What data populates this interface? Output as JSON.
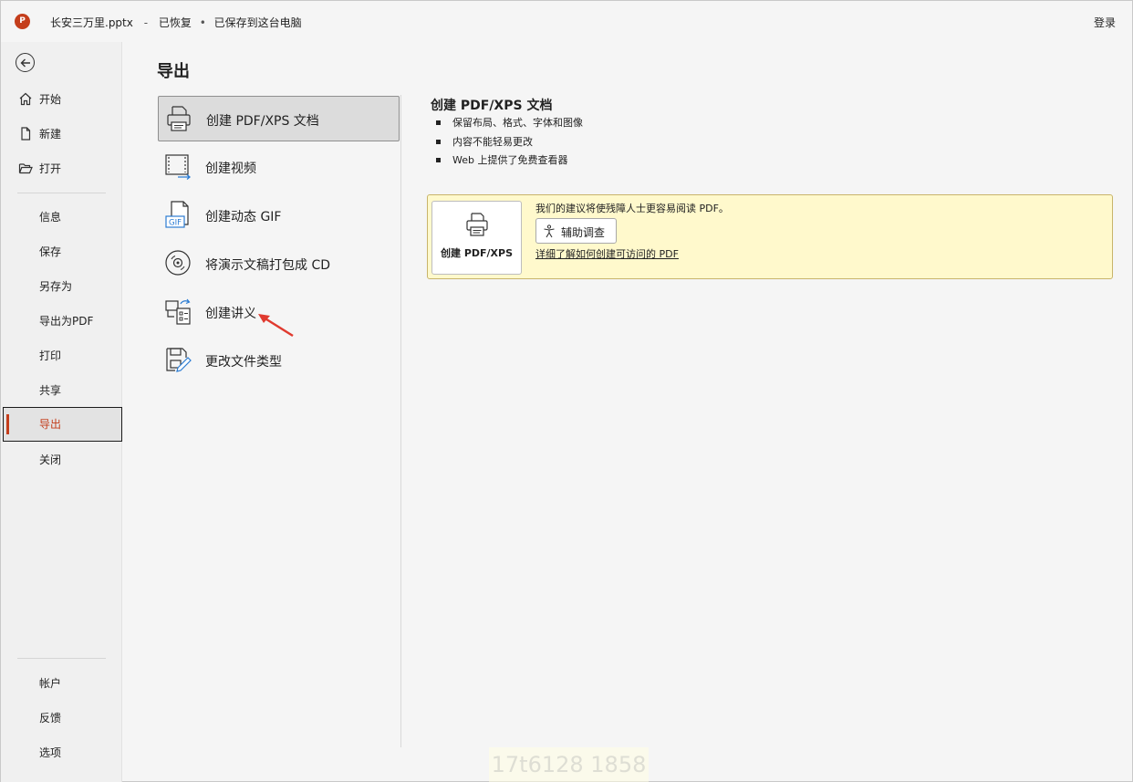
{
  "titlebar": {
    "logo_letter": "P",
    "filename": "长安三万里.pptx",
    "status_recovered": "已恢复",
    "status_saved": "已保存到这台电脑",
    "separator": "-",
    "bullet": "•",
    "signin": "登录"
  },
  "nav": {
    "items": [
      {
        "label": "开始",
        "icon": "home-icon"
      },
      {
        "label": "新建",
        "icon": "new-file-icon"
      },
      {
        "label": "打开",
        "icon": "folder-open-icon"
      },
      {
        "label": "信息"
      },
      {
        "label": "保存"
      },
      {
        "label": "另存为"
      },
      {
        "label": "导出为PDF"
      },
      {
        "label": "打印"
      },
      {
        "label": "共享"
      },
      {
        "label": "导出",
        "selected": true
      },
      {
        "label": "关闭"
      }
    ],
    "bottom": [
      {
        "label": "帐户"
      },
      {
        "label": "反馈"
      },
      {
        "label": "选项"
      }
    ]
  },
  "main": {
    "title": "导出",
    "options": [
      {
        "label": "创建 PDF/XPS 文档",
        "icon": "pdf-xps-icon",
        "selected": true
      },
      {
        "label": "创建视频",
        "icon": "video-icon"
      },
      {
        "label": "创建动态 GIF",
        "icon": "gif-icon"
      },
      {
        "label": "将演示文稿打包成 CD",
        "icon": "cd-icon"
      },
      {
        "label": "创建讲义",
        "icon": "handout-icon"
      },
      {
        "label": "更改文件类型",
        "icon": "change-type-icon"
      }
    ],
    "gif_badge": "GIF"
  },
  "detail": {
    "title": "创建 PDF/XPS 文档",
    "bullets": [
      "保留布局、格式、字体和图像",
      "内容不能轻易更改",
      "Web 上提供了免费查看器"
    ],
    "notice": {
      "big_button_label": "创建 PDF/XPS",
      "text": "我们的建议将使残障人士更容易阅读 PDF。",
      "accessibility_button": "辅助调查",
      "learn_link": "详细了解如何创建可访问的 PDF"
    }
  },
  "watermark": "17t6128 1858",
  "colors": {
    "accent": "#c43e1c",
    "notice_bg": "#fff9cc"
  }
}
